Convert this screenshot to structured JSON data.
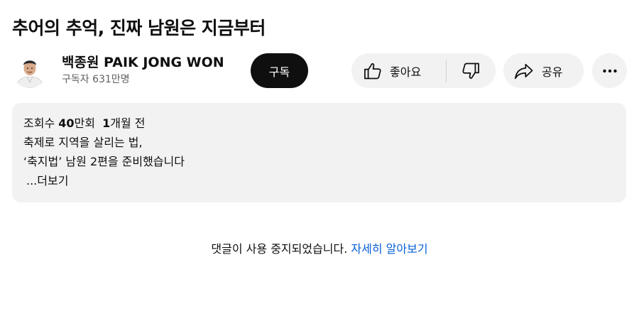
{
  "video": {
    "title": "추어의 추억, 진짜 남원은 지금부터"
  },
  "channel": {
    "name": "백종원 PAIK JONG WON",
    "subscribers": "구독자 631만명",
    "avatar_icon": "chef-avatar-icon"
  },
  "actions": {
    "subscribe_label": "구독",
    "like_label": "좋아요",
    "share_label": "공유",
    "like_icon": "thumbs-up-icon",
    "dislike_icon": "thumbs-down-icon",
    "share_icon": "share-arrow-icon",
    "more_icon": "more-horizontal-icon"
  },
  "description": {
    "views": "조회수 40만회",
    "date": "1개월 전",
    "lines": [
      "축제로 지역을 살리는 법,",
      "‘축지법’ 남원 2편을 준비했습니다"
    ],
    "more_label": "...더보기"
  },
  "comments": {
    "disabled_text": "댓글이 사용 중지되었습니다.",
    "learn_more_label": "자세히 알아보기"
  },
  "colors": {
    "subscribe_bg": "#0f0f0f",
    "chip_bg": "#f2f2f2",
    "link": "#065fd4",
    "secondary_text": "#606060"
  }
}
